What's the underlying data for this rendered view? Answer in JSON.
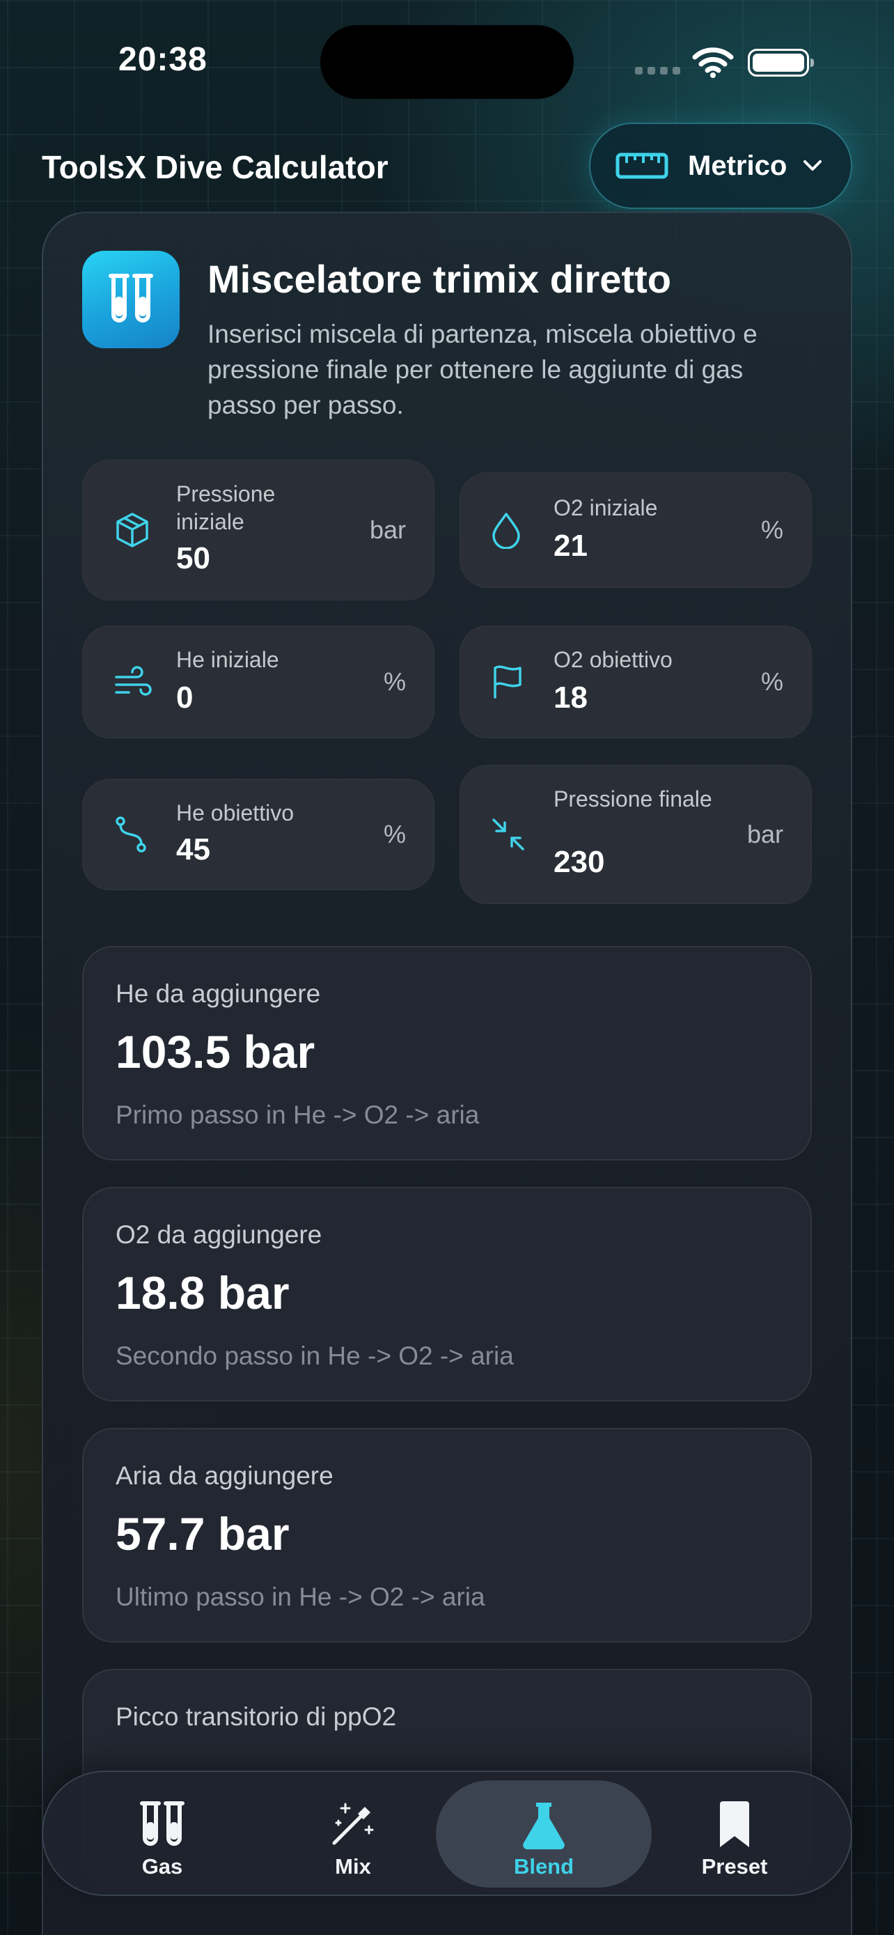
{
  "status_bar": {
    "time": "20:38"
  },
  "header": {
    "app_title": "ToolsX Dive Calculator",
    "unit_selector": {
      "label": "Metrico",
      "icon": "ruler-icon"
    }
  },
  "card": {
    "icon": "test-tubes-icon",
    "title": "Miscelatore trimix diretto",
    "description": "Inserisci miscela di partenza, miscela obiettivo e pressione finale per ottenere le aggiunte di gas passo per passo."
  },
  "inputs": [
    {
      "label": "Pressione iniziale",
      "value": "50",
      "unit": "bar",
      "icon": "box-icon"
    },
    {
      "label": "O2 iniziale",
      "value": "21",
      "unit": "%",
      "icon": "droplet-icon"
    },
    {
      "label": "He iniziale",
      "value": "0",
      "unit": "%",
      "icon": "wind-icon"
    },
    {
      "label": "O2 obiettivo",
      "value": "18",
      "unit": "%",
      "icon": "flag-icon"
    },
    {
      "label": "He obiettivo",
      "value": "45",
      "unit": "%",
      "icon": "route-icon"
    },
    {
      "label": "Pressione finale",
      "value": "230",
      "unit": "bar",
      "icon": "shrink-icon"
    }
  ],
  "results": [
    {
      "label": "He da aggiungere",
      "value": "103.5 bar",
      "note": "Primo passo in He -> O2 -> aria"
    },
    {
      "label": "O2 da aggiungere",
      "value": "18.8 bar",
      "note": "Secondo passo in He -> O2 -> aria"
    },
    {
      "label": "Aria da aggiungere",
      "value": "57.7 bar",
      "note": "Ultimo passo in He -> O2 -> aria"
    },
    {
      "label": "Picco transitorio di ppO2"
    }
  ],
  "tabbar": {
    "tabs": [
      {
        "label": "Gas",
        "icon": "test-tubes-icon",
        "active": false
      },
      {
        "label": "Mix",
        "icon": "magic-wand-icon",
        "active": false
      },
      {
        "label": "Blend",
        "icon": "flask-icon",
        "active": true
      },
      {
        "label": "Preset",
        "icon": "bookmark-icon",
        "active": false
      }
    ]
  },
  "colors": {
    "accent": "#3fd3ea",
    "icon_gradient_top": "#29d3f3",
    "icon_gradient_bottom": "#1683c7"
  }
}
